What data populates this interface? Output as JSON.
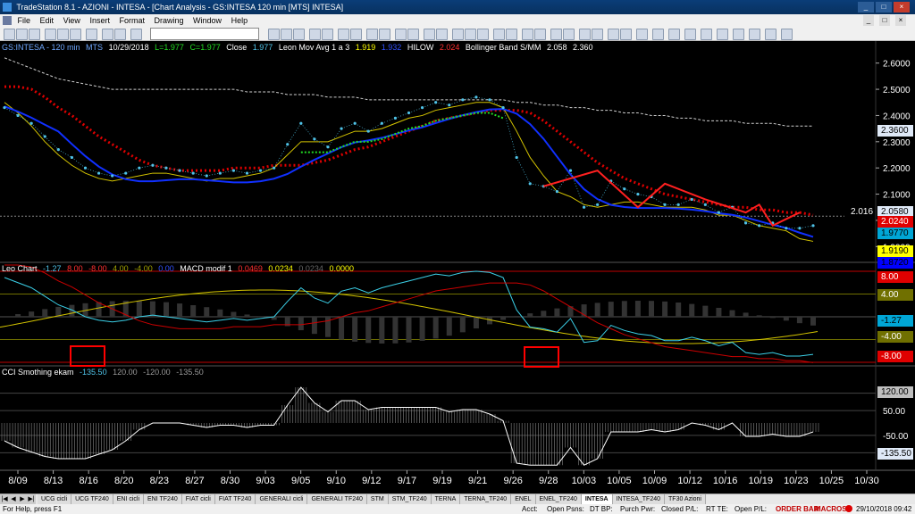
{
  "window": {
    "title": "TradeStation 8.1 - AZIONI - INTESA - [Chart Analysis - GS:INTESA  120 min  [MTS] INTESA]",
    "controls": [
      "_",
      "□",
      "×"
    ]
  },
  "menu": {
    "items": [
      "File",
      "Edit",
      "View",
      "Insert",
      "Format",
      "Drawing",
      "Window",
      "Help"
    ]
  },
  "price_header": {
    "symbol": "GS:INTESA - 120 min",
    "strategy": "MTS",
    "date": "10/29/2018",
    "low": "L=1.977",
    "close_eq": "C=1.977",
    "close_label": "Close",
    "close_val": "1.977",
    "leon_label": "Leon Mov Avg 1 a 3",
    "leon_v1": "1.919",
    "leon_v2": "1.932",
    "hilow_label": "HILOW",
    "hilow_val": "2.024",
    "boll_label": "Bollinger Band S/MM",
    "boll_v1": "2.058",
    "boll_v2": "2.360"
  },
  "leo_header": {
    "title": "Leo Chart",
    "v1": "-1.27",
    "v2": "8.00",
    "v3": "-8.00",
    "v4": "4.00",
    "v5": "-4.00",
    "v6": "0.00",
    "macd_label": "MACD modif 1",
    "macd_v1": "0.0469",
    "macd_v2": "0.0234",
    "macd_v3": "0.0234",
    "macd_v4": "0.0000"
  },
  "cci_header": {
    "title": "CCI Smothing ekam",
    "v1": "-135.50",
    "v2": "120.00",
    "v3": "-120.00",
    "v4": "-135.50"
  },
  "axes": {
    "price_ticks": [
      "2.6000",
      "2.5000",
      "2.4000",
      "2.3000",
      "2.2000",
      "2.1000",
      "2.0000",
      "1.9000"
    ],
    "price_last": "2.016",
    "leo_ticks": [
      "8.00",
      "4.00",
      "-1.27",
      "-4.00",
      "-8.00"
    ],
    "cci_ticks": [
      "120.00",
      "50.00",
      "-50.00",
      "-135.50"
    ],
    "x_ticks": [
      "8/09",
      "8/13",
      "8/16",
      "8/20",
      "8/23",
      "8/27",
      "8/30",
      "9/03",
      "9/05",
      "9/10",
      "9/12",
      "9/17",
      "9/19",
      "9/21",
      "9/26",
      "9/28",
      "10/03",
      "10/05",
      "10/09",
      "10/12",
      "10/16",
      "10/19",
      "10/23",
      "10/25",
      "10/30"
    ]
  },
  "price_tags": [
    {
      "text": "2.3600",
      "bg": "#dfe9f7",
      "fg": "#000000"
    },
    {
      "text": "2.0580",
      "bg": "#dfe9f7",
      "fg": "#000000"
    },
    {
      "text": "2.0240",
      "bg": "#e00000",
      "fg": "#ffffff"
    },
    {
      "text": "1.9770",
      "bg": "#00a6d6",
      "fg": "#000000"
    },
    {
      "text": "1.9190",
      "bg": "#ffff00",
      "fg": "#000000"
    },
    {
      "text": "1.8720",
      "bg": "#0000ff",
      "fg": "#000000"
    }
  ],
  "leo_tags": [
    {
      "text": "8.00",
      "bg": "#e00000",
      "fg": "#ffffff"
    },
    {
      "text": "4.00",
      "bg": "#707000",
      "fg": "#ffffff"
    },
    {
      "text": "-1.27",
      "bg": "#00a6d6",
      "fg": "#000000"
    },
    {
      "text": "-4.00",
      "bg": "#707000",
      "fg": "#ffffff"
    },
    {
      "text": "-8.00",
      "bg": "#e00000",
      "fg": "#ffffff"
    }
  ],
  "cci_tags": [
    {
      "text": "120.00",
      "bg": "#bfbfbf",
      "fg": "#000000"
    },
    {
      "text": "-135.50",
      "bg": "#dfe9f7",
      "fg": "#000000"
    }
  ],
  "tabs": {
    "items": [
      "UCG cicli",
      "UCG TF240",
      "ENI cicli",
      "ENI TF240",
      "FIAT cicli",
      "FIAT TF240",
      "GENERALI cicli",
      "GENERALI TF240",
      "STM",
      "STM_TF240",
      "TERNA",
      "TERNA_TF240",
      "ENEL",
      "ENEL_TF240",
      "INTESA",
      "INTESA_TF240",
      "TF30 Azioni"
    ],
    "active": "INTESA"
  },
  "status": {
    "help": "For Help, press F1",
    "acct": "Acct:",
    "open_psns": "Open Psns:",
    "dt_bp": "DT BP:",
    "purch_pwr": "Purch Pwr:",
    "closed_pl": "Closed P/L:",
    "rt_te": "RT TE:",
    "open_pl": "Open P/L:",
    "order_bar": "ORDER BAR",
    "macros": "MACROS",
    "datetime": "29/10/2018 09:42"
  },
  "colors": {
    "price_dots": "#4fc3e8",
    "blue_ma": "#1030ff",
    "yellow_ma": "#d4c400",
    "red_dots": "#e00000",
    "green_dots": "#22dd22",
    "red_line": "#ff2020",
    "grey_line": "#cfcfcf"
  },
  "chart_data": {
    "type": "line",
    "series": [
      {
        "name": "Close",
        "values": [
          2.43,
          2.4,
          2.37,
          2.32,
          2.27,
          2.24,
          2.2,
          2.18,
          2.17,
          2.18,
          2.2,
          2.21,
          2.2,
          2.19,
          2.18,
          2.17,
          2.18,
          2.19,
          2.18,
          2.19,
          2.2,
          2.29,
          2.37,
          2.31,
          2.28,
          2.35,
          2.37,
          2.34,
          2.37,
          2.39,
          2.41,
          2.43,
          2.45,
          2.44,
          2.46,
          2.47,
          2.46,
          2.43,
          2.24,
          2.14,
          2.13,
          2.11,
          2.19,
          2.05,
          2.06,
          2.15,
          2.12,
          2.1,
          2.09,
          2.06,
          2.06,
          2.08,
          2.06,
          2.03,
          2.05,
          1.99,
          1.98,
          1.99,
          1.97,
          1.97,
          1.98
        ]
      },
      {
        "name": "Leon Mov Avg 1 a 3",
        "values": [
          2.45,
          2.41,
          2.36,
          2.3,
          2.25,
          2.21,
          2.18,
          2.16,
          2.15,
          2.16,
          2.17,
          2.18,
          2.18,
          2.17,
          2.16,
          2.15,
          2.16,
          2.16,
          2.17,
          2.18,
          2.2,
          2.25,
          2.3,
          2.3,
          2.3,
          2.32,
          2.34,
          2.34,
          2.35,
          2.37,
          2.39,
          2.4,
          2.42,
          2.43,
          2.44,
          2.45,
          2.45,
          2.43,
          2.34,
          2.24,
          2.17,
          2.11,
          2.09,
          2.06,
          2.05,
          2.06,
          2.07,
          2.07,
          2.06,
          2.05,
          2.05,
          2.05,
          2.04,
          2.02,
          2.02,
          2.0,
          1.98,
          1.97,
          1.96,
          1.93,
          1.92
        ]
      },
      {
        "name": "HILOW",
        "values": [
          2.51,
          2.51,
          2.5,
          2.47,
          2.43,
          2.4,
          2.36,
          2.32,
          2.29,
          2.26,
          2.23,
          2.21,
          2.2,
          2.19,
          2.19,
          2.19,
          2.19,
          2.2,
          2.2,
          2.2,
          2.21,
          2.21,
          2.21,
          2.22,
          2.23,
          2.25,
          2.27,
          2.28,
          2.3,
          2.32,
          2.34,
          2.36,
          2.38,
          2.39,
          2.4,
          2.41,
          2.42,
          2.42,
          2.42,
          2.41,
          2.38,
          2.34,
          2.3,
          2.26,
          2.22,
          2.19,
          2.16,
          2.14,
          2.12,
          2.1,
          2.09,
          2.08,
          2.07,
          2.06,
          2.05,
          2.05,
          2.04,
          2.04,
          2.03,
          2.03,
          2.02
        ]
      },
      {
        "name": "Bollinger Band S/MM",
        "values": [
          2.62,
          2.6,
          2.58,
          2.56,
          2.54,
          2.53,
          2.52,
          2.51,
          2.5,
          2.5,
          2.5,
          2.5,
          2.5,
          2.5,
          2.5,
          2.5,
          2.5,
          2.5,
          2.49,
          2.49,
          2.49,
          2.48,
          2.48,
          2.48,
          2.47,
          2.47,
          2.47,
          2.46,
          2.46,
          2.46,
          2.46,
          2.46,
          2.46,
          2.46,
          2.46,
          2.46,
          2.46,
          2.46,
          2.45,
          2.45,
          2.44,
          2.44,
          2.43,
          2.43,
          2.42,
          2.42,
          2.41,
          2.41,
          2.4,
          2.4,
          2.39,
          2.39,
          2.38,
          2.38,
          2.38,
          2.37,
          2.37,
          2.37,
          2.36,
          2.36,
          2.36
        ]
      }
    ],
    "xlabel": "",
    "ylabel": "",
    "ylim": [
      1.85,
      2.65
    ],
    "legend": "top-left",
    "grid": false
  }
}
